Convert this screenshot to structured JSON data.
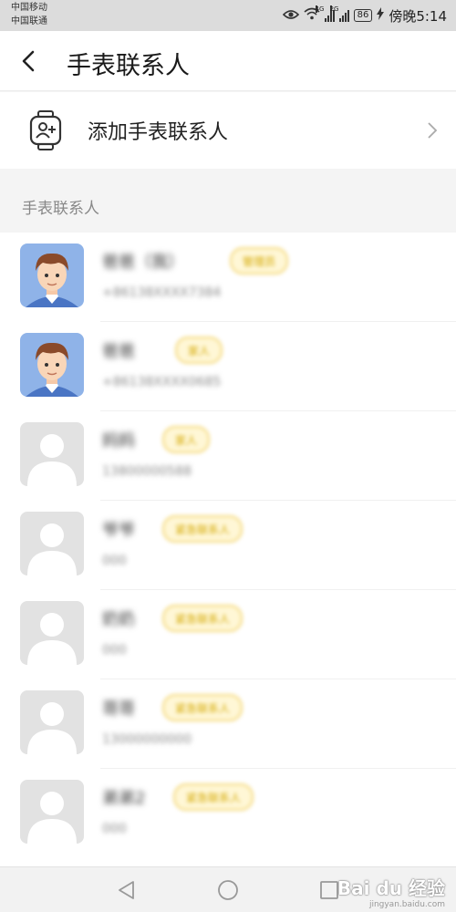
{
  "status_bar": {
    "carrier_1": "中国移动",
    "carrier_2": "中国联通",
    "network_1": "4G",
    "network_2": "2G",
    "battery": "86",
    "time": "傍晚5:14"
  },
  "header": {
    "title": "手表联系人"
  },
  "add_contact": {
    "label": "添加手表联系人"
  },
  "section": {
    "title": "手表联系人"
  },
  "contacts": [
    {
      "name": "爸爸（我）",
      "phone": "+86138XXXX7384",
      "tag": "管理员",
      "avatar": "cartoon-boy"
    },
    {
      "name": "爸爸",
      "phone": "+86138XXXX0685",
      "tag": "家人",
      "avatar": "cartoon-boy"
    },
    {
      "name": "妈妈",
      "phone": "13800000588",
      "tag": "家人",
      "avatar": "default"
    },
    {
      "name": "爷爷",
      "phone": "000",
      "tag": "紧急联系人",
      "avatar": "default"
    },
    {
      "name": "奶奶",
      "phone": "000",
      "tag": "紧急联系人",
      "avatar": "default"
    },
    {
      "name": "哥哥",
      "phone": "13000000000",
      "tag": "紧急联系人",
      "avatar": "default"
    },
    {
      "name": "弟弟2",
      "phone": "000",
      "tag": "紧急联系人",
      "avatar": "default"
    }
  ],
  "watermark": {
    "brand": "Bai du 经验",
    "url": "jingyan.baidu.com"
  },
  "colors": {
    "tag_border": "#f4d87a",
    "tag_text": "#d4a800",
    "tag_bg": "#fff7d6",
    "avatar_blue": "#8fb3e8"
  }
}
